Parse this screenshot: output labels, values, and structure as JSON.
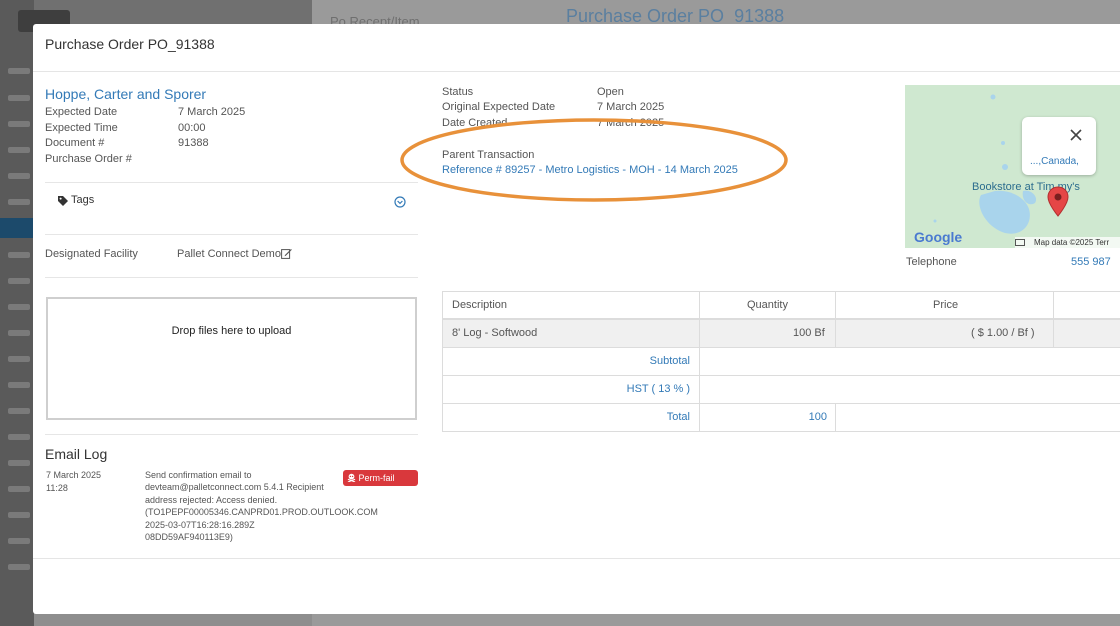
{
  "background": {
    "page_title": "Purchase Order PO_91388",
    "subtitle": "Po Recept/Item"
  },
  "modal": {
    "title": "Purchase Order PO_91388",
    "company": "Hoppe, Carter and Sporer",
    "left_details": [
      {
        "label": "Expected Date",
        "value": "7 March 2025"
      },
      {
        "label": "Expected Time",
        "value": "00:00"
      },
      {
        "label": "Document #",
        "value": "91388"
      },
      {
        "label": "Purchase Order #",
        "value": ""
      }
    ],
    "tags_label": "Tags",
    "facility": {
      "label": "Designated Facility",
      "value": "Pallet Connect Demo"
    },
    "dropzone_text": "Drop files here to upload",
    "email_log": {
      "title": "Email Log",
      "entries": [
        {
          "date": "7 March 2025",
          "time": "11:28",
          "lines": [
            "Send confirmation email to",
            "devteam@palletconnect.com 5.4.1 Recipient",
            "address rejected: Access denied.",
            "(TO1PEPF00005346.CANPRD01.PROD.OUTLOOK.COM",
            "2025-03-07T16:28:16.289Z",
            "08DD59AF940113E9)"
          ],
          "badge": "Perm-fail"
        }
      ]
    },
    "right_details": [
      {
        "label": "Status",
        "value": "Open"
      },
      {
        "label": "Original Expected Date",
        "value": "7 March 2025"
      },
      {
        "label": "Date Created",
        "value": "7 March 2025"
      }
    ],
    "parent_transaction": {
      "label": "Parent Transaction",
      "value": "Reference # 89257 - Metro Logistics - MOH - 14 March 2025"
    },
    "map": {
      "popup_link": "...,Canada,",
      "place_label": "Bookstore at Tim my's",
      "brand": "Google",
      "attribution": "Map data ©2025   Terr"
    },
    "telephone": {
      "label": "Telephone",
      "value": "555 987"
    },
    "items_table": {
      "headers": [
        "Description",
        "Quantity",
        "Price"
      ],
      "rows": [
        {
          "description": "8' Log - Softwood",
          "quantity": "100 Bf",
          "price": "( $ 1.00 / Bf )"
        }
      ],
      "summary": [
        {
          "label": "Subtotal",
          "value": ""
        },
        {
          "label": "HST ( 13 % )",
          "value": ""
        },
        {
          "label": "Total",
          "value": "100"
        }
      ]
    },
    "colors": {
      "link": "#337ab7",
      "badge_danger": "#d9383c",
      "annotation": "#e8913a"
    }
  }
}
